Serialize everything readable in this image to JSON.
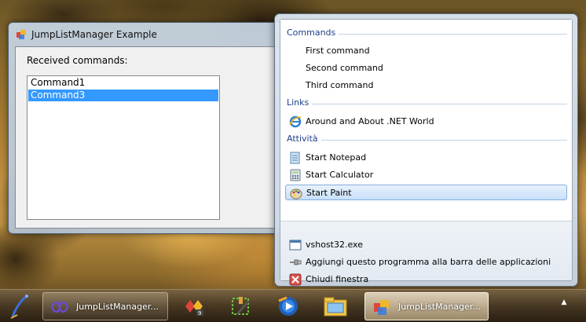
{
  "app_window": {
    "title": "JumpListManager Example",
    "received_label": "Received commands:",
    "commands": [
      {
        "label": "Command1",
        "selected": false
      },
      {
        "label": "Command3",
        "selected": true
      }
    ]
  },
  "jumplist": {
    "categories": {
      "commands": "Commands",
      "links": "Links",
      "tasks": "Attività"
    },
    "command_items": [
      "First command",
      "Second command",
      "Third command"
    ],
    "link_items": [
      "Around and About .NET World"
    ],
    "task_items": [
      "Start Notepad",
      "Start Calculator",
      "Start Paint"
    ],
    "footer_items": [
      "vshost32.exe",
      "Aggiungi questo programma alla barra delle applicazioni",
      "Chiudi finestra"
    ]
  },
  "taskbar": {
    "buttons": [
      {
        "label": "JumpListManager..."
      },
      {
        "label": "JumpListManager..."
      }
    ],
    "pinned_icons": [
      "visual-studio-icon",
      "tools-icon",
      "media-player-icon",
      "file-explorer-icon"
    ],
    "tray_chevron": "▲"
  },
  "colors": {
    "selection": "#3399ff",
    "category_text": "#1e3f8a"
  }
}
